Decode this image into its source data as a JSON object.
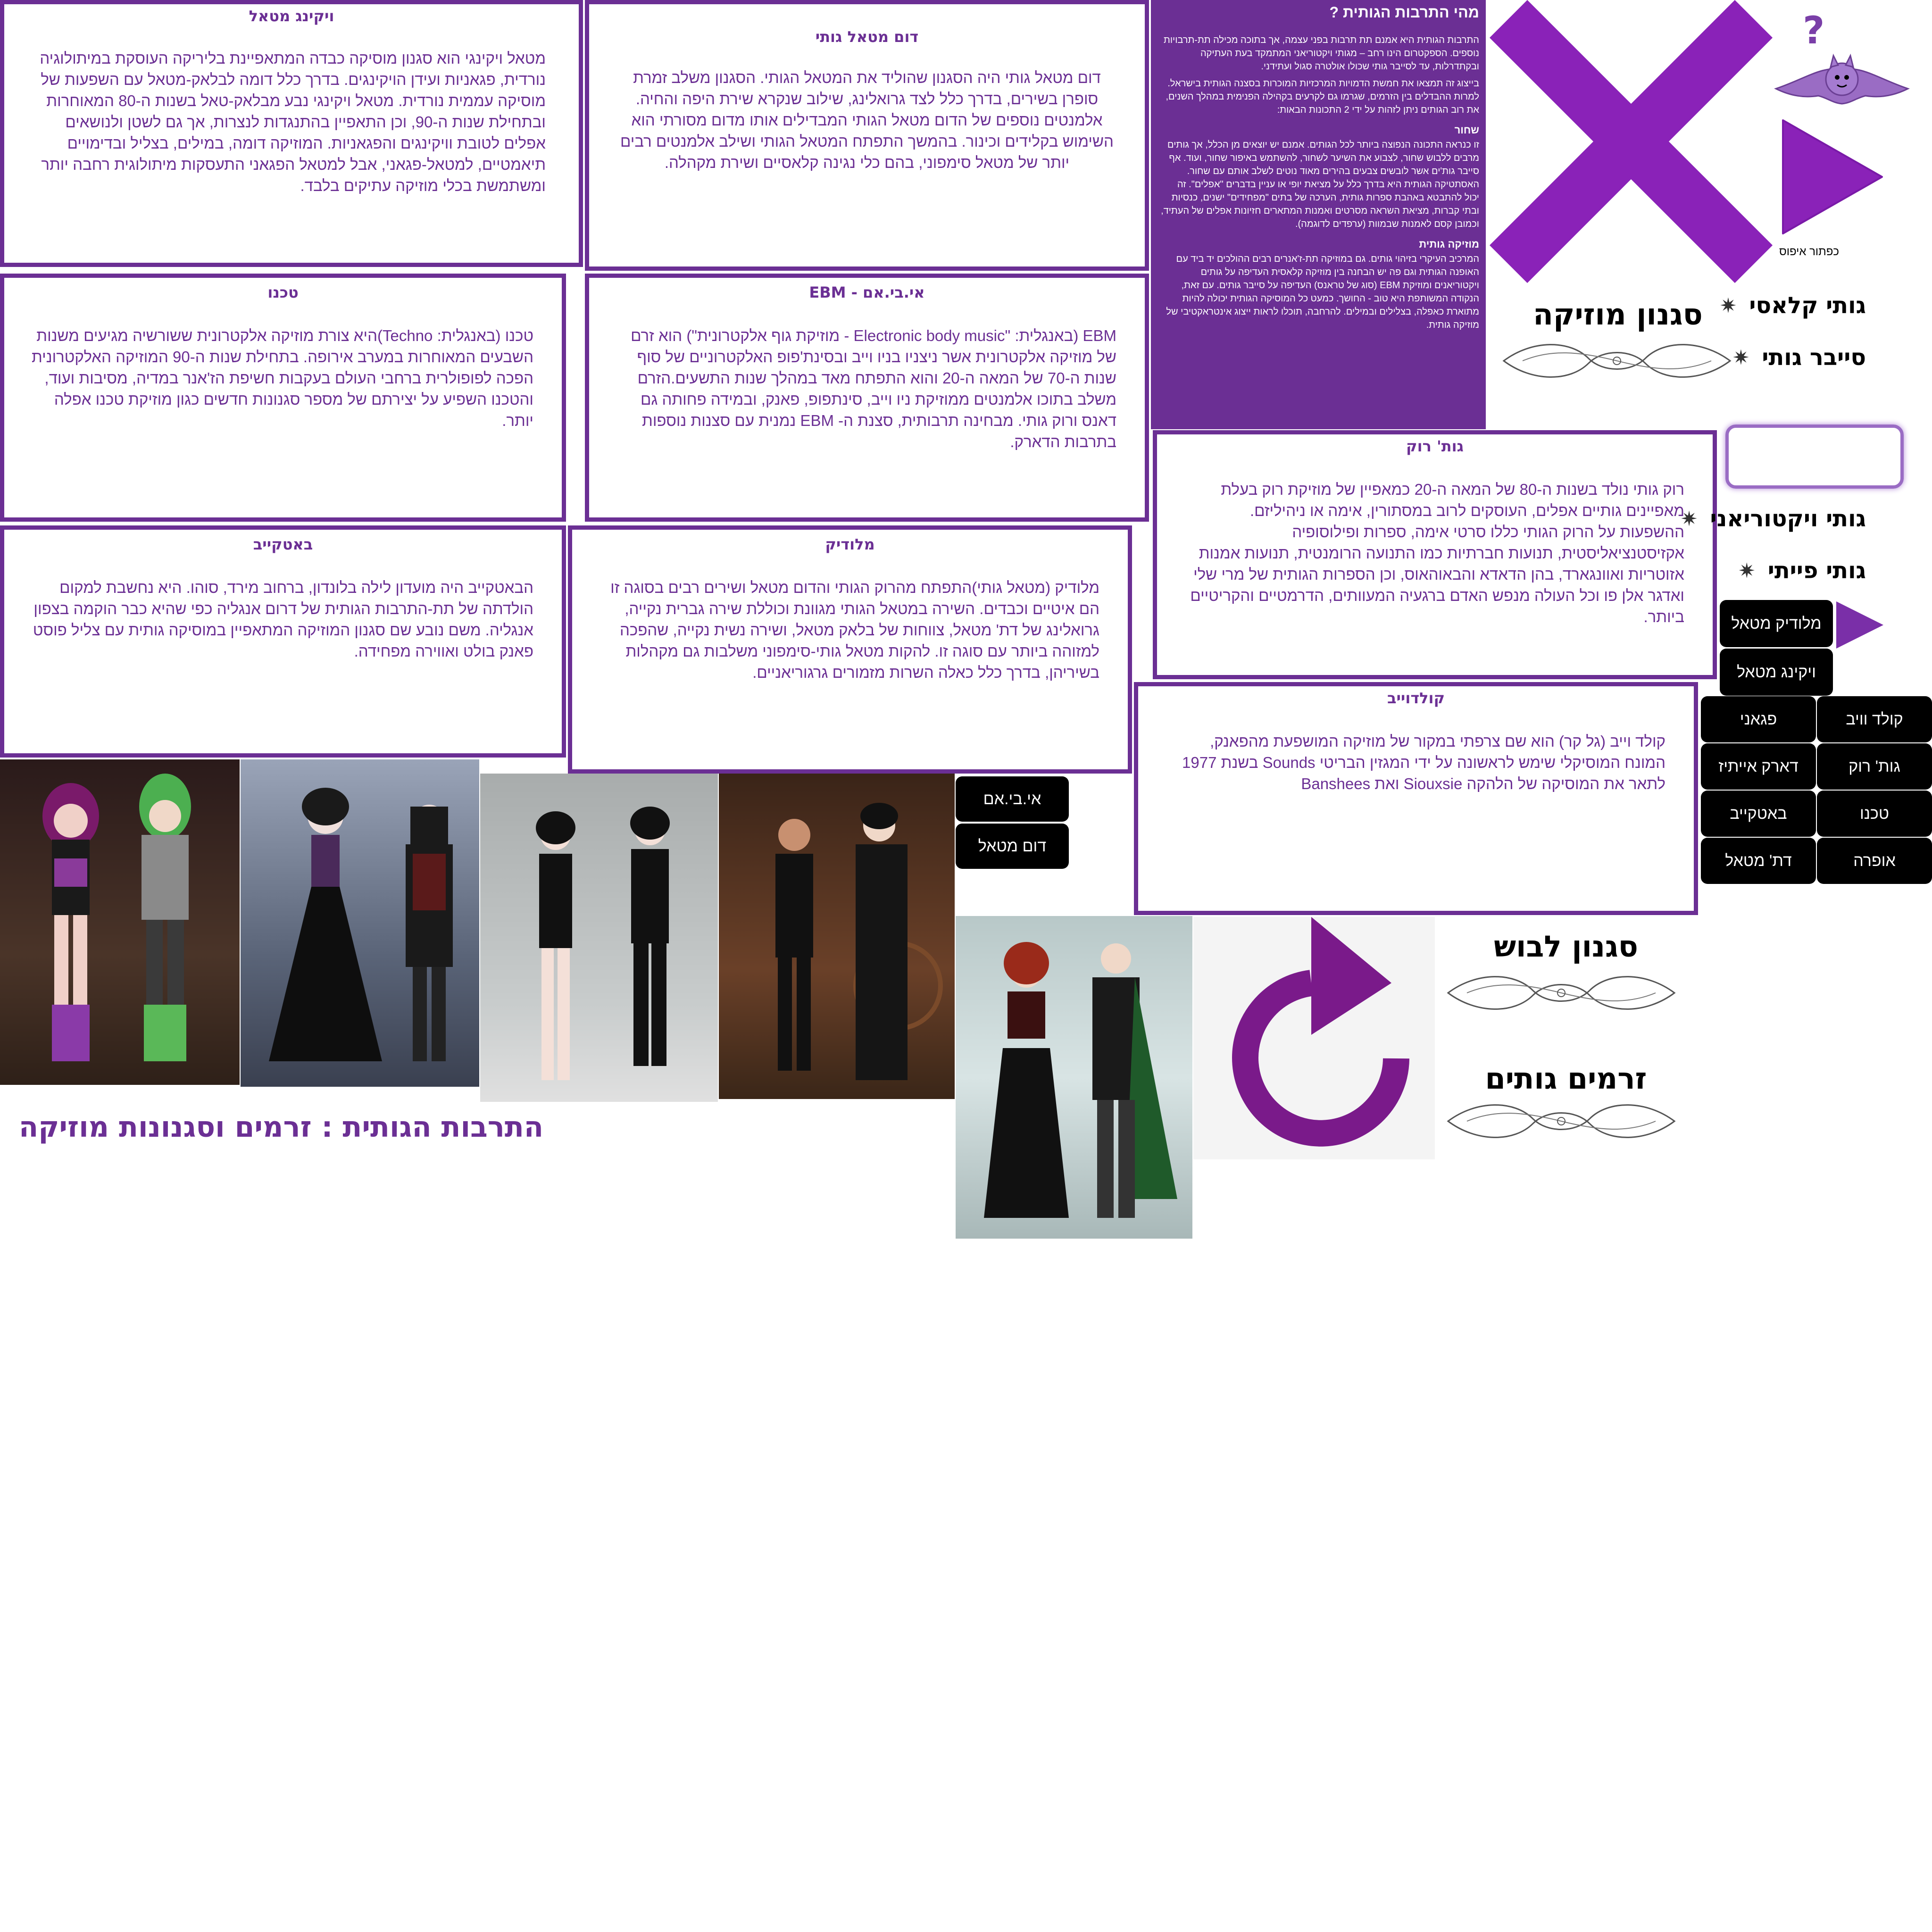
{
  "colors": {
    "accent": "#6b2f94",
    "accent_dark": "#6a1b9a",
    "pill_bg": "#000000",
    "text_on_pill": "#ffffff"
  },
  "boxes": {
    "viking": {
      "title": "ויקינג מטאל",
      "body": "מטאל ויקינגי הוא סגנון מוסיקה כבדה המתאפיינת בליריקה העוסקת במיתולוגיה נורדית, פגאניות ועידן הויקינגים. בדרך כלל דומה לבלאק-מטאל עם השפעות של מוסיקה עממית נורדית. מטאל ויקינגי נבע מבלאק-טאל בשנות ה-80 המאוחרות ובתחילת שנות ה-90, וכן התאפיין בהתנגדות לנצרות, אך גם לשטן ולנושאים אפלים לטובת וויקינגים והפגאניות. המוזיקה דומה, במילים, בצליל ובדימויים תיאמטיים, למטאל-פגאני, אבל למטאל הפגאני התעסקות מיתולוגית רחבה יותר ומשתמשת בכלי מוזיקה עתיקים בלבד."
    },
    "doom": {
      "title": "דום מטאל גותי",
      "body": "דום מטאל גותי היה הסגנון שהוליד את המטאל הגותי. הסגנון משלב זמרת סופרן בשירים, בדרך כלל לצד גרואלינג, שילוב שנקרא שירת היפה והחיה. אלמנטים נוספים של הדום מטאל הגותי המבדילים אותו מדום מסורתי הוא השימוש בקלידים וכינור. בהמשך התפתח המטאל הגותי ושילב אלמנטים רבים יותר של מטאל סימפוני, בהם כלי נגינה קלאסיים ושירת מקהלה."
    },
    "techno": {
      "title": "טכנו",
      "body": "טכנו (באנגלית: Techno)היא צורת מוזיקה אלקטרונית ששורשיה מגיעים משנות השבעים המאוחרות במערב אירופה. בתחילת שנות ה-90 המוזיקה האלקטרונית הפכה לפופולרית ברחבי העולם בעקבות חשיפת הז'אנר במדיה, מסיבות ועוד, והטכנו השפיע על יצירתם של מספר סגנונות חדשים כגון מוזיקת טכנו אפלה יותר."
    },
    "ebm": {
      "title": "אי.בי.אם - EBM",
      "body": "EBM (באנגלית: \"Electronic body music - מוזיקת גוף אלקטרונית\") הוא זרם של מוזיקה אלקטרונית אשר ניצניו בניו וייב ובסינת'פופ האלקטרוניים של סוף שנות ה-70 של המאה ה-20 והוא התפתח מאד במהלך שנות התשעים.הזרם משלב בתוכו אלמנטים ממוזיקת ניו וייב, סינתפופ, פאנק, ובמידה פחותה גם דאנס ורוק גותי. מבחינה תרבותית, סצנת ה- EBM נמנית עם סצנות נוספות בתרבות הדארק."
    },
    "batcave": {
      "title": "באטקייב",
      "body": "הבאטקייב היה מועדון לילה בלונדון, ברחוב מירד, סוהו. היא נחשבת למקום הולדתה של תת-התרבות הגותית של דרום אנגליה כפי שהיא כבר הוקמה בצפון אנגליה. משם נובע שם סגנון המוזיקה המתאפיין במוסיקה גותית עם צליל פוסט פאנק בולט ואווירה מפחידה."
    },
    "melodic": {
      "title": "מלודיק",
      "body": "מלודיק (מטאל גותי)התפתח מהרוק הגותי והדום מטאל ושירים רבים בסוגה זו הם איטיים וכבדים. השירה במטאל הגותי מגוונת וכוללת שירה גברית נקייה, גרואלינג של דת' מטאל, צווחות של בלאק מטאל, ושירה נשית נקייה, שהפכה למזוהה ביותר עם סוגה זו. להקות מטאל גותי-סימפוני משלבות גם מקהלות בשיריהן, בדרך כלל כאלה השרות מזמורים גרגוריאניים."
    },
    "gothrock": {
      "title": "גות' רוק",
      "body": "רוק גותי נולד בשנות ה-80 של המאה ה-20 כמאפיין של מוזיקת רוק בעלת מאפיינים גותיים אפלים, העוסקים לרוב במסתורין, אימה או ניהיליזם. ההשפעות על הרוק הגותי כללו סרטי אימה, ספרות ופילוסופיה אקזיסטנציאליסטית, תנועות חברתיות כמו התנועה הרומנטית, תנועות אמנות אזוטריות ואוונגארד, בהן הדאדא והבאוהאוס, וכן הספרות הגותית של מרי שלי ואדגר אלן פו וכל העולה מנפש האדם ברגעיה המעוותים, הדרמטיים והקריטיים ביותר."
    },
    "coldwave": {
      "title": "קולדוייב",
      "body": "קולד וייב (גל קר) הוא שם צרפתי במקור של מוזיקה המושפעת מהפאנק, המונח המוסיקלי שימש לראשונה על ידי המגזין הבריטי Sounds בשנת 1977 לתאר את המוסיקה של הלהקה Siouxsie ואת Banshees"
    }
  },
  "intro": {
    "title": "מהי התרבות הגותית ?",
    "p1": "התרבות הגותית היא אמנם תת תרבות בפני עצמה, אך בתוכה מכילה תת-תרבויות נוספים. הספקטרום הינו רחב – מגותי ויקטוריאני המתמקד בעת העתיקה ובקתדרלות, עד לסייבר גותי שכולו אולטרה סגול ועתידני.",
    "p2": "בייצוג זה תמצאו את חמשת הדמויות המרכזיות המוכרות בסצנה הגותית בישראל. למרות ההבדלים בין הזרמים, שגרמו גם לקרעים בקהילה הפנימית במהלך השנים, את רוב הגותים ניתן לזהות על ידי 2 התכונות הבאות:",
    "h_black": "שחור",
    "p3": "זו כנראה התכונה הנפוצה ביותר לכל הגותים. אמנם יש יוצאים מן הכלל, אך גותים מרבים ללבוש שחור, לצבוע את השיער לשחור, להשתמש באיפור שחור, ועוד. אף סייבר גות'ים אשר לובשים צבעים בהירים מאוד נוטים לשלב אותם עם שחור. האסתטיקה הגותית היא בדרך כלל על מציאת יופי או עניין בדברים \"אפלים\". זה יכול להתבטא באהבת ספרות גותית, הערכה של בתים \"מפחידים\" ישנים, כנסיות ובתי קברות, מציאת השראה מסרטים ואמנות המתארים חזיונות אפלים של העתיד, וכמובן קסם לאמנות שבמוות (ערפדים לדוגמה).",
    "h_music": "מוזיקה גותית",
    "p4": "המרכיב העיקרי בזיהוי גותים. גם במוזיקה תת-ז'אנרים רבים ההולכים יד ביד עם האופנה הגותית וגם פה יש הבחנה בין מוזיקה קלאסית העדיפה על גותים ויקטוריאנים ומוזיקת EBM (סוג של טראנס) העדיפה על סייבר גותים. עם זאת, הנקודה המשותפת היא טוב - החושך. כמעט כל המוסיקה הגותית יכולה להיות מתוארת כאפלה, בצלילים ובמילים. להרחבה, תוכלו לראות ייצוג אינטראקטיבי של מוזיקה גותית."
  },
  "nav": {
    "question_mark": "?",
    "reset_label": "כפתור איפוס",
    "music_style_heading": "סגנון מוזיקה",
    "clothing_style_heading": "סגנון לבוש",
    "goth_streams_heading": "זרמים גותים",
    "menu": [
      "גותי קלאסי",
      "סייבר גותי",
      "גותי ויקטוריאני",
      "גותי פייתי"
    ],
    "pills": {
      "melodic_metal": "מלודיק מטאל",
      "viking_metal": "ויקינג מטאל",
      "cold_wave": "קולד וויב",
      "pagan": "פגאני",
      "goth_rock": "גות' רוק",
      "dark_eighties": "דארק אייתיז",
      "techno": "טכנו",
      "batcave": "באטקייב",
      "opera": "אופרה",
      "death_metal": "דת' מטאל",
      "ebm": "אי.בי.אם",
      "doom_metal": "דום מטאל"
    }
  },
  "footer": {
    "caption": "התרבות הגותית : זרמים וסגנונות מוזיקה"
  },
  "icons": [
    "close-x-icon",
    "bat-icon",
    "play-triangle-icon",
    "refresh-arrow-icon",
    "gear-bullet-icon",
    "scroll-flourish-icon"
  ]
}
